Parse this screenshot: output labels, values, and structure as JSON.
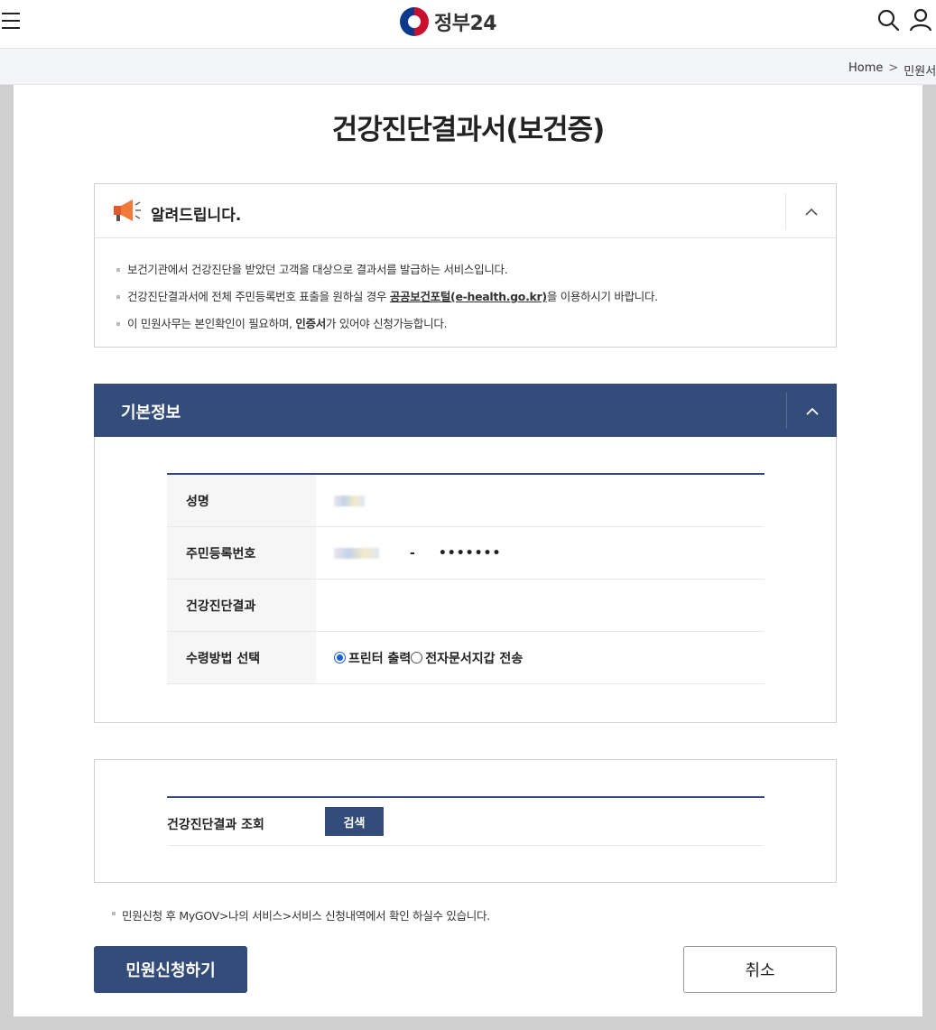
{
  "header": {
    "logo_text": "정부24",
    "icons": [
      "menu-icon",
      "search-icon",
      "user-icon"
    ]
  },
  "breadcrumb": {
    "home": "Home",
    "separator": ">",
    "current": "민원서비"
  },
  "page_title": "건강진단결과서(보건증)",
  "notice": {
    "title": "알려드립니다.",
    "items": [
      "보건기관에서 건강진단을 받았던 고객을 대상으로 결과서를 발급하는 서비스입니다.",
      "건강진단결과서에 전체 주민등록번호 표출을 원하실 경우 ",
      "이 민원사무는 본인확인이 필요하며, "
    ],
    "item2_link": "공공보건포털(e-health.go.kr)",
    "item2_tail": "을 이용하시기 바랍니다.",
    "item3_bold": "인증서",
    "item3_tail": "가 있어야 신청가능합니다."
  },
  "basic_info": {
    "title": "기본정보",
    "rows": {
      "name_label": "성명",
      "rrn_label": "주민등록번호",
      "rrn_dash": "-",
      "rrn_masked": "•••••••",
      "result_label": "건강진단결과",
      "receive_label": "수령방법 선택"
    },
    "receive_options": [
      "프린터 출력",
      "전자문서지갑 전송"
    ],
    "receive_selected": "프린터 출력"
  },
  "lookup": {
    "label": "건강진단결과 조회",
    "button": "검색"
  },
  "footnote": "민원신청 후 MyGOV>나의 서비스>서비스 신청내역에서 확인 하실수 있습니다.",
  "actions": {
    "apply": "민원신청하기",
    "cancel": "취소"
  },
  "colors": {
    "primary": "#334c79",
    "radio_selected": "#1a5fd6",
    "page_background": "#cfcfcf"
  }
}
